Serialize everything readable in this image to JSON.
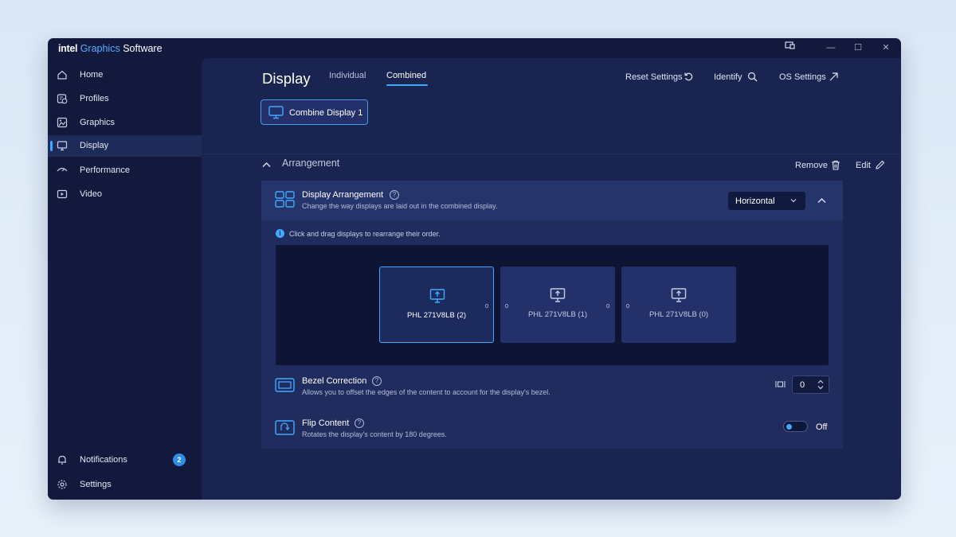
{
  "app": {
    "brand_part1": "intel",
    "brand_part2": "Graphics",
    "brand_part3": "Software"
  },
  "window_controls": {
    "feedback_icon": "feedback-icon",
    "minimize": "—",
    "maximize": "☐",
    "close": "✕"
  },
  "sidebar": {
    "items": [
      {
        "label": "Home",
        "icon": "home-icon"
      },
      {
        "label": "Profiles",
        "icon": "profiles-icon"
      },
      {
        "label": "Graphics",
        "icon": "graphics-icon"
      },
      {
        "label": "Display",
        "icon": "display-icon",
        "active": true
      },
      {
        "label": "Performance",
        "icon": "performance-icon"
      },
      {
        "label": "Video",
        "icon": "video-icon"
      }
    ],
    "notifications": {
      "label": "Notifications",
      "count": "2",
      "icon": "bell-icon"
    },
    "settings": {
      "label": "Settings",
      "icon": "gear-icon"
    }
  },
  "header": {
    "title": "Display",
    "tabs": [
      {
        "label": "Individual"
      },
      {
        "label": "Combined",
        "active": true
      }
    ],
    "actions": {
      "reset": "Reset Settings",
      "identify": "Identify",
      "os_settings": "OS Settings"
    },
    "combine_button": "Combine Display 1"
  },
  "arrangement": {
    "section_title": "Arrangement",
    "remove": "Remove",
    "edit": "Edit",
    "display_arrangement": {
      "title": "Display Arrangement",
      "help": "?",
      "description": "Change the way displays are laid out in the combined display.",
      "selected": "Horizontal"
    },
    "info": "Click and drag displays to rearrange their order.",
    "monitors": [
      {
        "label": "PHL 271V8LB (2)",
        "selected": true
      },
      {
        "label": "PHL 271V8LB (1)",
        "selected": false
      },
      {
        "label": "PHL 271V8LB (0)",
        "selected": false
      }
    ],
    "gaps": [
      "0",
      "0",
      "0",
      "0"
    ],
    "bezel": {
      "title": "Bezel Correction",
      "help": "?",
      "description": "Allows you to offset the edges of the content to account for the display's bezel.",
      "value": "0"
    },
    "flip": {
      "title": "Flip Content",
      "help": "?",
      "description": "Rotates the display's content by 180 degrees.",
      "state": "Off"
    }
  },
  "colors": {
    "accent": "#3fa9ff",
    "background": "#12193d",
    "main": "#1a2450",
    "card": "#202c5e"
  }
}
